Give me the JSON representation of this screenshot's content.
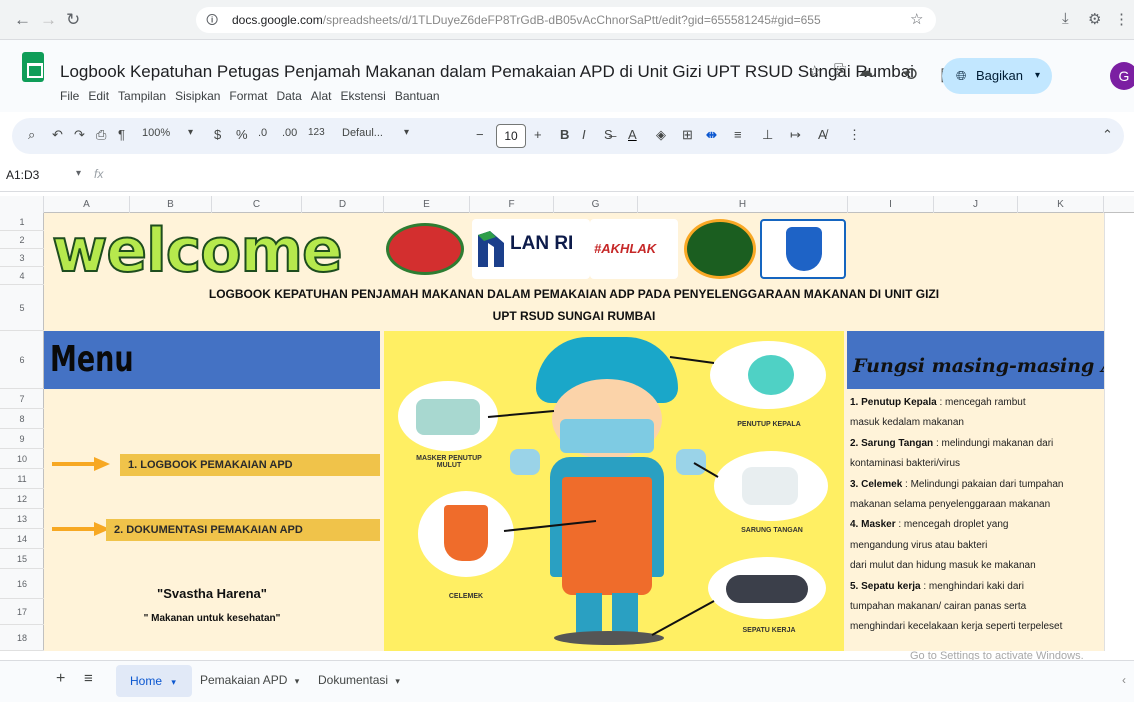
{
  "browser": {
    "url_domain": "docs.google.com",
    "url_path": "/spreadsheets/d/1TLDuyeZ6deFP8TrGdB-dB05vAcChnorSaPtt/edit?gid=655581245#gid=655"
  },
  "app": {
    "title": "Logbook Kepatuhan Petugas Penjamah Makanan dalam Pemakaian APD di Unit Gizi UPT RSUD Sungai Rumbai",
    "menus": [
      "File",
      "Edit",
      "Tampilan",
      "Sisipkan",
      "Format",
      "Data",
      "Alat",
      "Ekstensi",
      "Bantuan"
    ],
    "share_label": "Bagikan",
    "avatar_letter": "G"
  },
  "toolbar": {
    "zoom": "100%",
    "currency": "$",
    "percent": "%",
    "number_format": "123",
    "font": "Defaul...",
    "font_size": "10",
    "bold": "B",
    "italic": "I"
  },
  "formula": {
    "name_box": "A1:D3",
    "fx": "fx"
  },
  "columns": [
    "A",
    "B",
    "C",
    "D",
    "E",
    "F",
    "G",
    "H",
    "I",
    "J",
    "K"
  ],
  "rows": [
    "1",
    "2",
    "3",
    "4",
    "5",
    "6",
    "7",
    "8",
    "9",
    "10",
    "11",
    "12",
    "13",
    "14",
    "15",
    "16",
    "17",
    "18"
  ],
  "sheet": {
    "welcome": "welcome",
    "logo_lanri": "LAN RI",
    "logo_akhlak": "#AKHLAK",
    "heading_line1": "LOGBOOK KEPATUHAN PENJAMAH MAKANAN DALAM PEMAKAIAN ADP PADA PENYELENGGARAAN MAKANAN DI UNIT GIZI",
    "heading_line2": "UPT RSUD SUNGAI RUMBAI",
    "menu_title": "Menu",
    "menu_item_1": "1. LOGBOOK PEMAKAIAN APD",
    "menu_item_2": "2. DOKUMENTASI PEMAKAIAN APD",
    "motto": "\"Svastha Harena\"",
    "motto_sub": "\" Makanan untuk kesehatan\"",
    "captions": {
      "masker": "MASKER PENUTUP MULUT",
      "penutup_kepala": "PENUTUP KEPALA",
      "sarung_tangan": "SARUNG TANGAN",
      "celemek": "CELEMEK",
      "sepatu_kerja": "SEPATU KERJA"
    },
    "fungsi_title": "Fungsi masing-masing APD",
    "fungsi": [
      {
        "label": "1. Penutup Kepala",
        "text": " : mencegah rambut"
      },
      {
        "label": "",
        "text": "masuk kedalam makanan"
      },
      {
        "label": "2. Sarung Tangan",
        "text": " : melindungi makanan dari"
      },
      {
        "label": "",
        "text": "kontaminasi bakteri/virus"
      },
      {
        "label": "3. Celemek",
        "text": " : Melindungi pakaian dari tumpahan"
      },
      {
        "label": "",
        "text": "makanan selama penyelenggaraan makanan"
      },
      {
        "label": "4. Masker",
        "text": " : mencegah droplet yang"
      },
      {
        "label": "",
        "text": "mengandung virus atau bakteri"
      },
      {
        "label": "",
        "text": "dari mulut dan hidung masuk ke makanan"
      },
      {
        "label": "5. Sepatu kerja",
        "text": " : menghindari kaki dari"
      },
      {
        "label": "",
        "text": "tumpahan makanan/ cairan panas serta"
      },
      {
        "label": "",
        "text": "menghindari kecelakaan kerja seperti terpeleset"
      }
    ]
  },
  "watermark": "Go to Settings to activate Windows.",
  "tabs": {
    "home": "Home",
    "pemakaian": "Pemakaian APD",
    "dokumentasi": "Dokumentasi"
  }
}
